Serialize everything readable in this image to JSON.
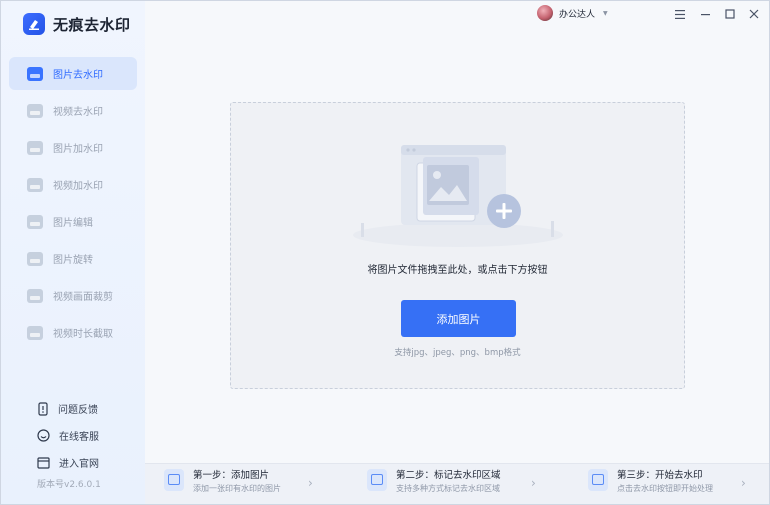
{
  "app": {
    "name": "无痕去水印",
    "version": "版本号v2.6.0.1"
  },
  "user": {
    "name": "办公达人"
  },
  "sidebar": {
    "items": [
      {
        "label": "图片去水印",
        "active": true
      },
      {
        "label": "视频去水印",
        "active": false
      },
      {
        "label": "图片加水印",
        "active": false
      },
      {
        "label": "视频加水印",
        "active": false
      },
      {
        "label": "图片编辑",
        "active": false
      },
      {
        "label": "图片旋转",
        "active": false
      },
      {
        "label": "视频画面裁剪",
        "active": false
      },
      {
        "label": "视频时长截取",
        "active": false
      }
    ],
    "bottom_links": [
      {
        "label": "问题反馈",
        "icon": "feedback-icon"
      },
      {
        "label": "在线客服",
        "icon": "headset-icon"
      },
      {
        "label": "进入官网",
        "icon": "website-icon"
      }
    ]
  },
  "dropzone": {
    "hint": "将图片文件拖拽至此处，或点击下方按钮",
    "button_label": "添加图片",
    "formats": "支持jpg、jpeg、png、bmp格式"
  },
  "steps": [
    {
      "title": "第一步：添加图片",
      "desc": "添加一张印有水印的图片"
    },
    {
      "title": "第二步：标记去水印区域",
      "desc": "支持多种方式标记去水印区域"
    },
    {
      "title": "第三步：开始去水印",
      "desc": "点击去水印按钮即开始处理"
    }
  ],
  "colors": {
    "accent": "#3670f5",
    "sidebar_active_bg": "#dae6fc",
    "text_primary": "#1d2433",
    "text_muted": "#8f98a8"
  }
}
